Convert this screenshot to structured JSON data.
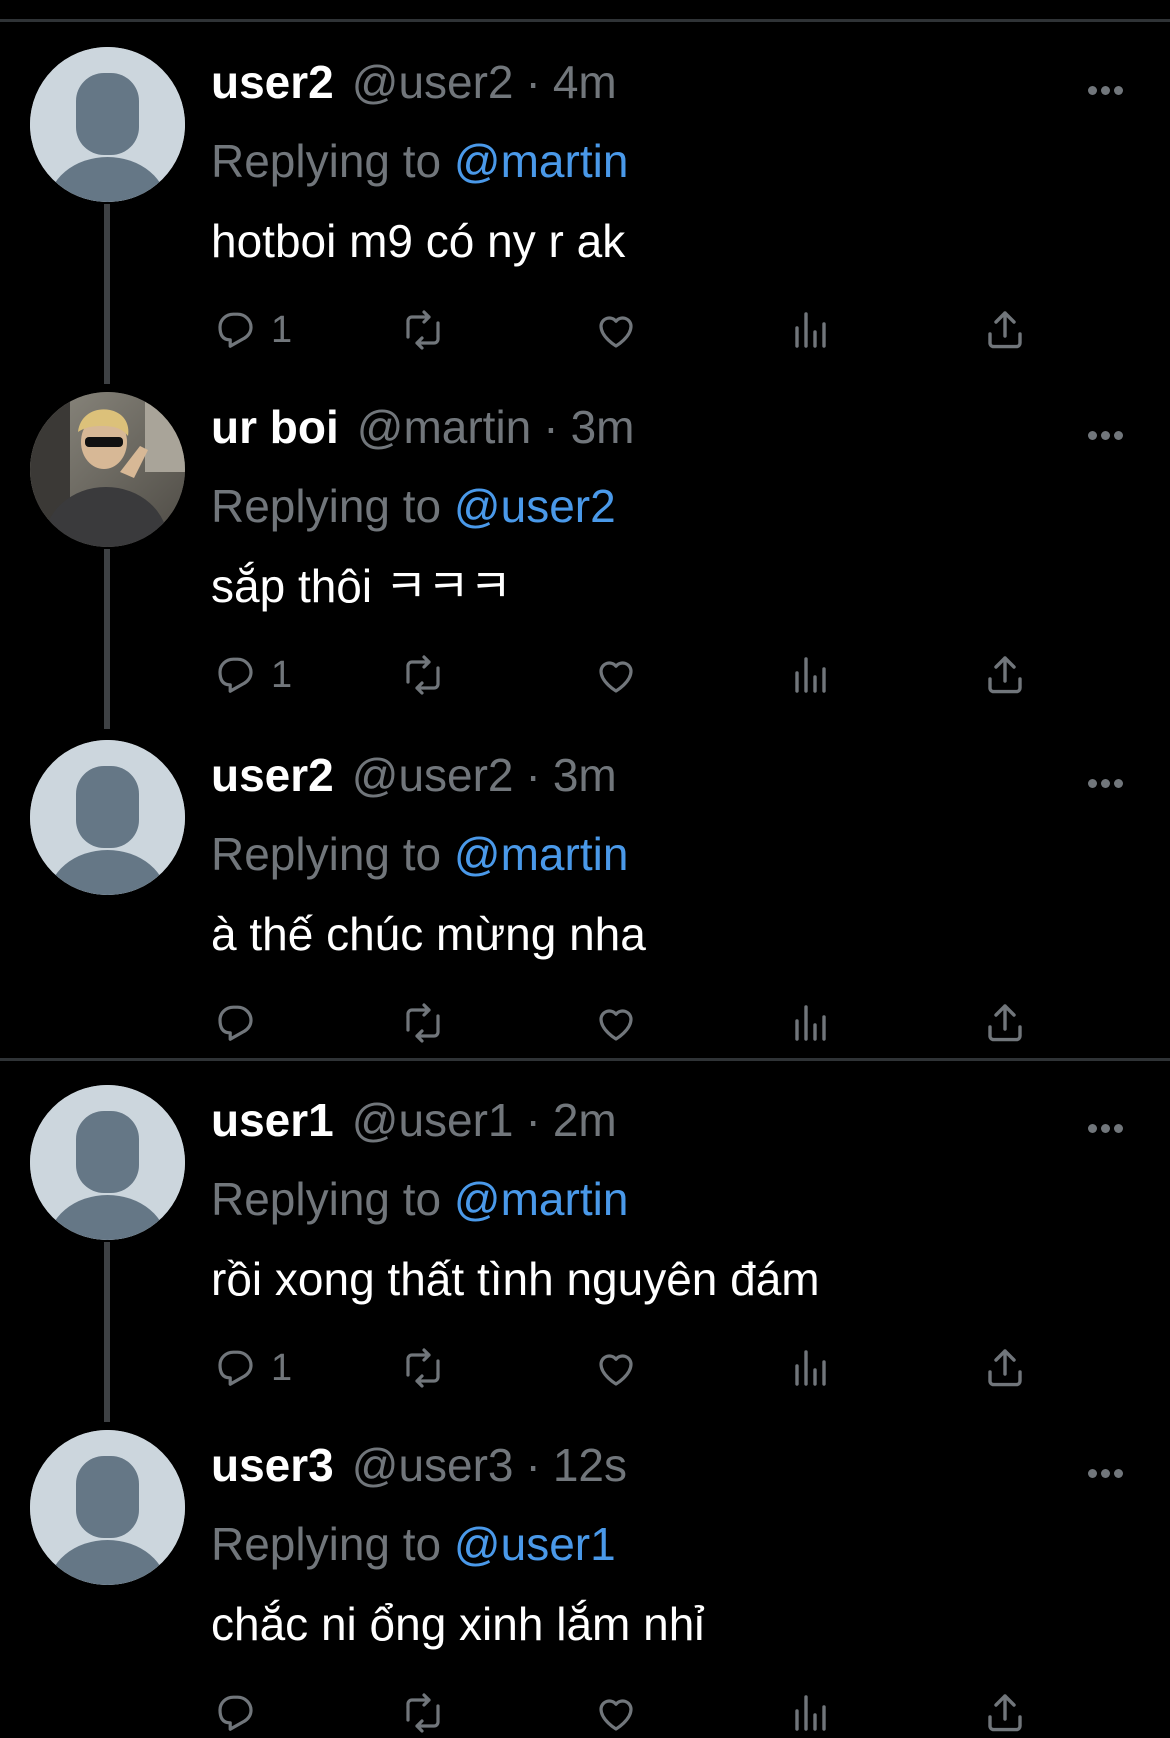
{
  "colors": {
    "background": "#000000",
    "name": "#ffffff",
    "muted": "#71767b",
    "mention": "#4a99e9",
    "divider": "#2f3336"
  },
  "icons": {
    "reply": "reply-icon",
    "retweet": "retweet-icon",
    "like": "heart-icon",
    "views": "views-icon",
    "share": "share-icon",
    "more": "more-icon"
  },
  "tweets": [
    {
      "name": "user2",
      "handle": "@user2",
      "separator": "·",
      "time": "4m",
      "replying_prefix": "Replying to",
      "replying_to": "@martin",
      "text": "hotboi m9 có ny r ak",
      "reply_count": "1",
      "avatar": "default-avatar"
    },
    {
      "name": "ur boi",
      "handle": "@martin",
      "separator": "·",
      "time": "3m",
      "replying_prefix": "Replying to",
      "replying_to": "@user2",
      "text": "sắp thôi ㅋㅋㅋ",
      "reply_count": "1",
      "avatar": "photo-avatar"
    },
    {
      "name": "user2",
      "handle": "@user2",
      "separator": "·",
      "time": "3m",
      "replying_prefix": "Replying to",
      "replying_to": "@martin",
      "text": "à thế chúc mừng nha",
      "reply_count": "",
      "avatar": "default-avatar"
    },
    {
      "name": "user1",
      "handle": "@user1",
      "separator": "·",
      "time": "2m",
      "replying_prefix": "Replying to",
      "replying_to": "@martin",
      "text": "rồi xong thất tình nguyên đám",
      "reply_count": "1",
      "avatar": "default-avatar"
    },
    {
      "name": "user3",
      "handle": "@user3",
      "separator": "·",
      "time": "12s",
      "replying_prefix": "Replying to",
      "replying_to": "@user1",
      "text": "chắc ni ổng xinh lắm nhỉ",
      "reply_count": "",
      "avatar": "default-avatar"
    }
  ]
}
